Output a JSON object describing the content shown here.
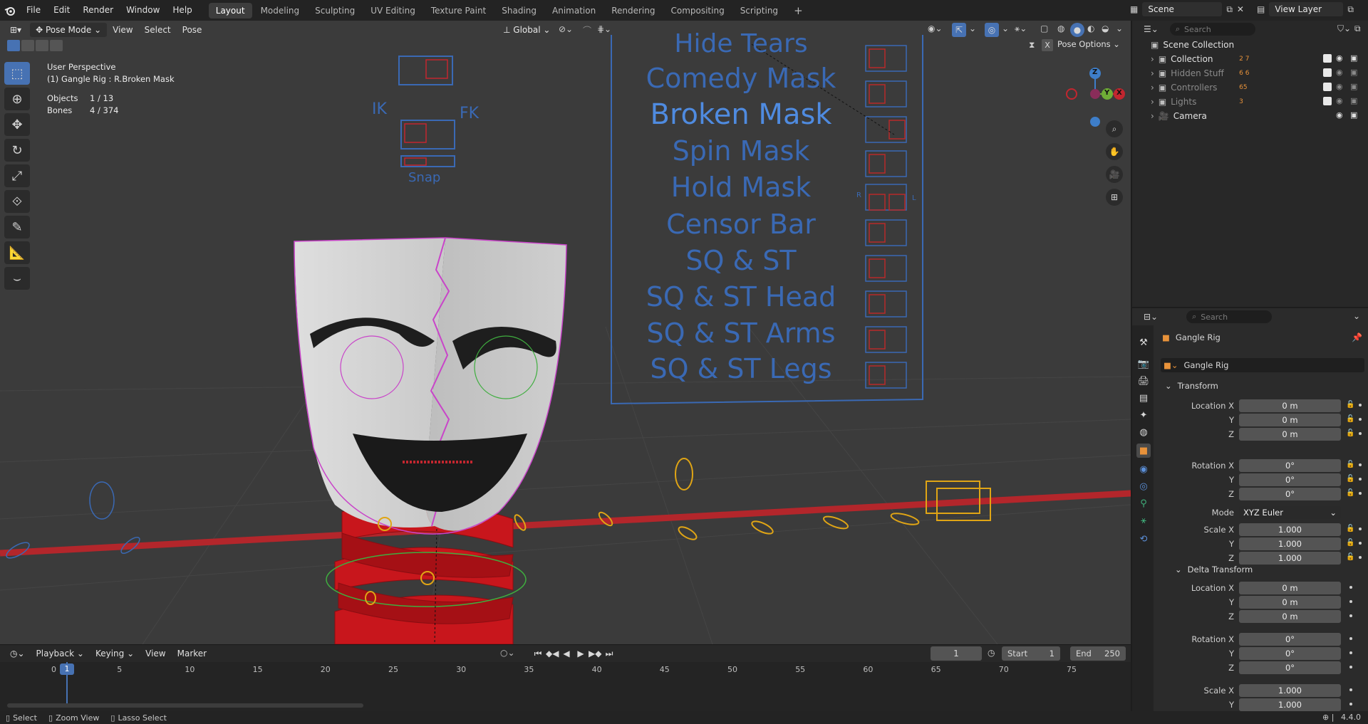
{
  "topbar": {
    "menus": [
      "File",
      "Edit",
      "Render",
      "Window",
      "Help"
    ],
    "workspaces": [
      "Layout",
      "Modeling",
      "Sculpting",
      "UV Editing",
      "Texture Paint",
      "Shading",
      "Animation",
      "Rendering",
      "Compositing",
      "Scripting"
    ],
    "active_workspace": "Layout",
    "add_workspace": "+",
    "scene": "Scene",
    "view_layer": "View Layer"
  },
  "viewport": {
    "mode": "Pose Mode",
    "menus": [
      "View",
      "Select",
      "Pose"
    ],
    "orientation": "Global",
    "pose_options": "Pose Options",
    "close_x": "X",
    "info": {
      "perspective": "User Perspective",
      "active": "(1) Gangle Rig : R.Broken Mask",
      "objects_label": "Objects",
      "objects_value": "1 / 13",
      "bones_label": "Bones",
      "bones_value": "4 / 374"
    },
    "gizmo": {
      "z": "Z",
      "y": "Y",
      "x": "X"
    },
    "controls": {
      "labels": [
        "Hide Tears",
        "Comedy Mask",
        "Broken Mask",
        "Spin Mask",
        "Hold Mask",
        "Censor Bar",
        "SQ & ST",
        "SQ & ST Head",
        "SQ & ST Arms",
        "SQ & ST Legs"
      ],
      "ik": "IK",
      "fk": "FK",
      "snap": "Snap",
      "r": "R",
      "l": "L"
    }
  },
  "timeline": {
    "menus": [
      "Playback",
      "Keying",
      "View",
      "Marker"
    ],
    "current_frame": "1",
    "start_label": "Start",
    "start_value": "1",
    "end_label": "End",
    "end_value": "250",
    "ticks": [
      "0",
      "5",
      "10",
      "15",
      "20",
      "25",
      "30",
      "35",
      "40",
      "45",
      "50",
      "55",
      "60",
      "65",
      "70",
      "75"
    ],
    "playhead": "1"
  },
  "statusbar": {
    "select": "Select",
    "zoom": "Zoom View",
    "lasso": "Lasso Select",
    "version": "4.4.0"
  },
  "outliner": {
    "search_placeholder": "Search",
    "root": "Scene Collection",
    "items": [
      {
        "label": "Collection",
        "badges": "2 7",
        "dim": false
      },
      {
        "label": "Hidden Stuff",
        "badges": "6 6",
        "dim": true
      },
      {
        "label": "Controllers",
        "badges": "65",
        "dim": true
      },
      {
        "label": "Lights",
        "badges": "3",
        "dim": true
      },
      {
        "label": "Camera",
        "badges": "",
        "dim": false
      }
    ]
  },
  "properties": {
    "search_placeholder": "Search",
    "object_name": "Gangle Rig",
    "data_name": "Gangle Rig",
    "transform_header": "Transform",
    "delta_header": "Delta Transform",
    "transform_rows": [
      {
        "label": "Location X",
        "value": "0 m"
      },
      {
        "label": "Y",
        "value": "0 m"
      },
      {
        "label": "Z",
        "value": "0 m"
      },
      {
        "label": "Rotation X",
        "value": "0°"
      },
      {
        "label": "Y",
        "value": "0°"
      },
      {
        "label": "Z",
        "value": "0°"
      }
    ],
    "mode_label": "Mode",
    "mode_value": "XYZ Euler",
    "scale_rows": [
      {
        "label": "Scale X",
        "value": "1.000"
      },
      {
        "label": "Y",
        "value": "1.000"
      },
      {
        "label": "Z",
        "value": "1.000"
      }
    ],
    "delta_rows": [
      {
        "label": "Location X",
        "value": "0 m"
      },
      {
        "label": "Y",
        "value": "0 m"
      },
      {
        "label": "Z",
        "value": "0 m"
      },
      {
        "label": "Rotation X",
        "value": "0°"
      },
      {
        "label": "Y",
        "value": "0°"
      },
      {
        "label": "Z",
        "value": "0°"
      },
      {
        "label": "Scale X",
        "value": "1.000"
      },
      {
        "label": "Y",
        "value": "1.000"
      }
    ]
  },
  "colors": {
    "accent": "#4772b3",
    "axis_red": "#c2262f",
    "control_blue": "#3a69b4",
    "bone_pink": "#c944c9",
    "bone_green": "#3fae3f",
    "bone_yellow": "#e0a515"
  }
}
